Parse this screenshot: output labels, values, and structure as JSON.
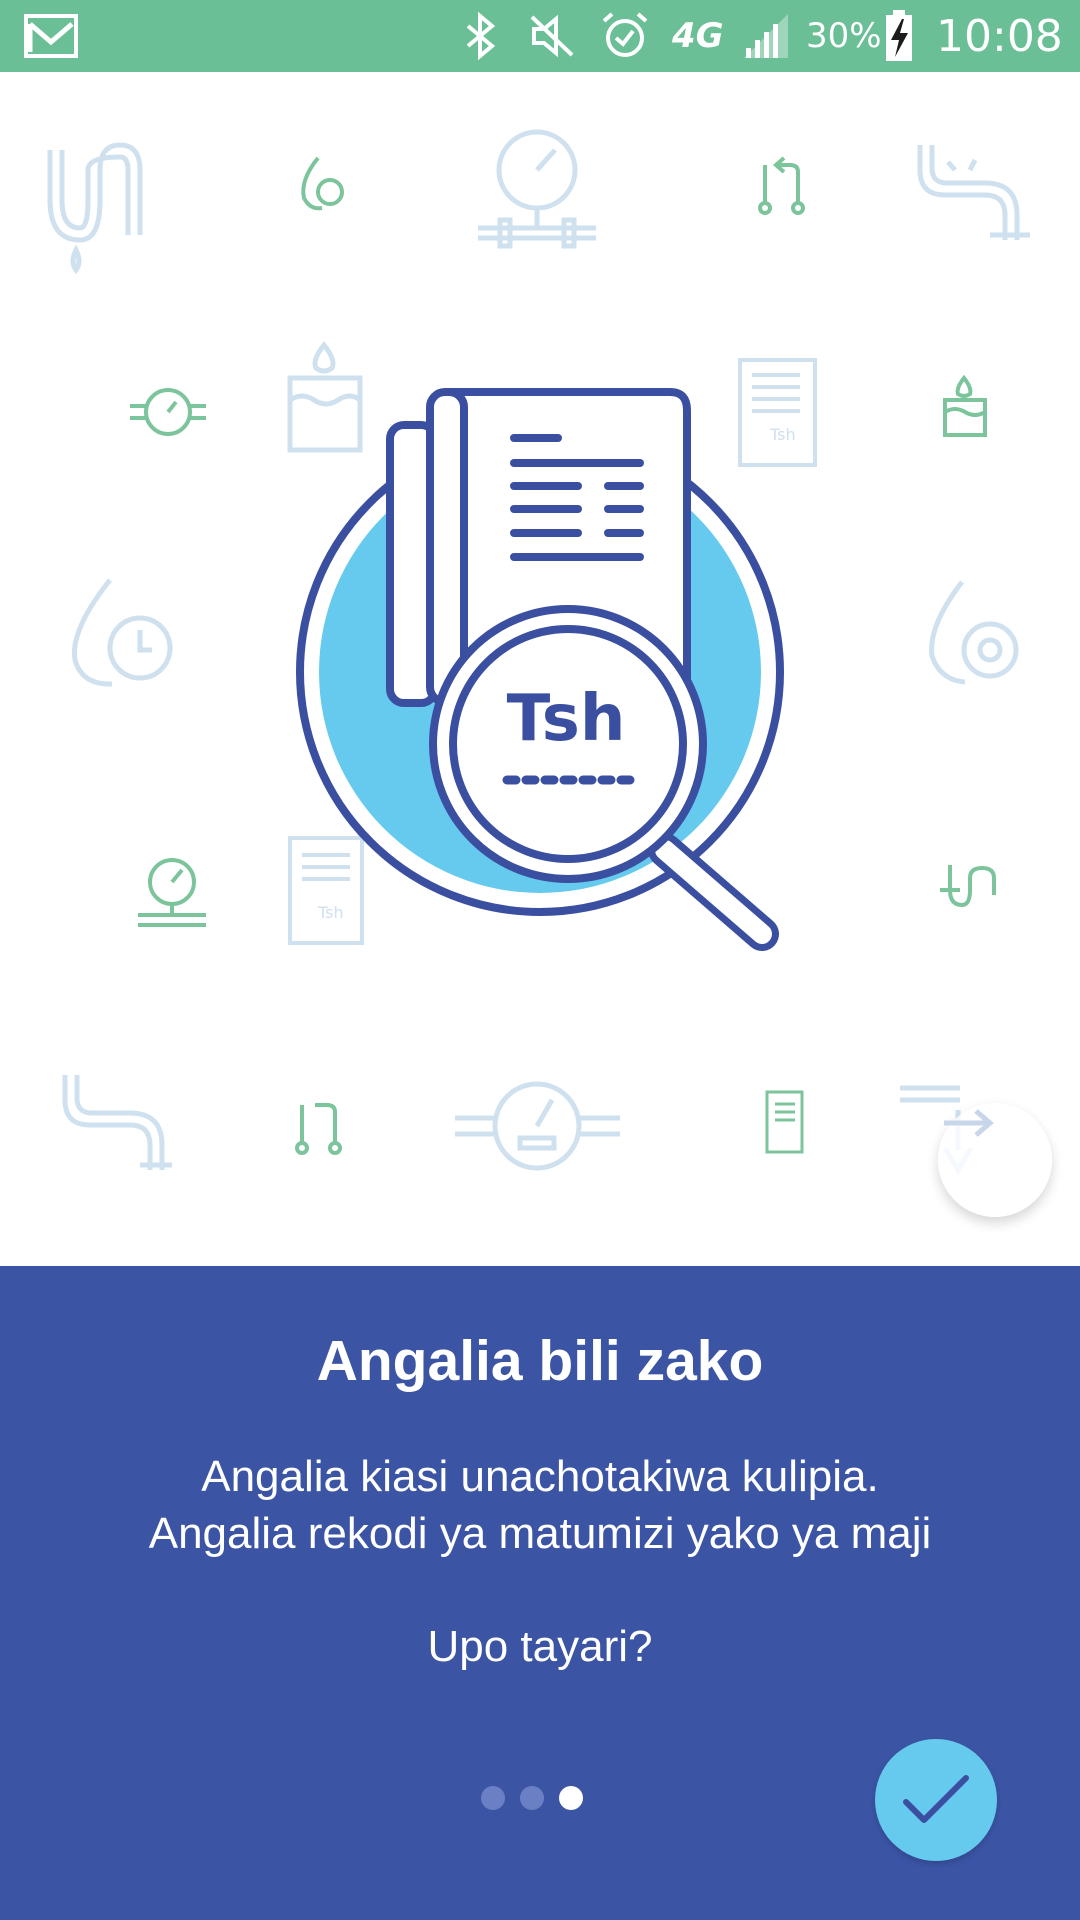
{
  "status_bar": {
    "battery_percent": "30%",
    "time": "10:08",
    "network": "4G",
    "icons": [
      "gmail-icon",
      "bluetooth-icon",
      "mute-icon",
      "alarm-icon",
      "signal-icon",
      "battery-charging-icon"
    ]
  },
  "illustration": {
    "currency_label": "Tsh",
    "small_receipt_label": "Tsh"
  },
  "onboarding": {
    "title": "Angalia bili zako",
    "description_line1": "Angalia kiasi unachotakiwa kulipia.",
    "description_line2": "Angalia rekodi ya matumizi yako ya maji",
    "prompt": "Upo tayari?",
    "page_index": 3,
    "page_count": 3
  },
  "colors": {
    "status_bar": "#6bbf97",
    "panel": "#3b54a4",
    "accent": "#66caee",
    "navy": "#3b4fa0",
    "pale_blue_icon": "#cfe0ef",
    "green_icon": "#7cc49b"
  }
}
